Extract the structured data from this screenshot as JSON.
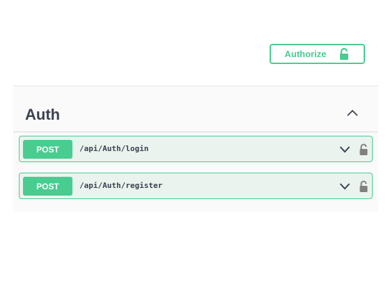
{
  "header": {
    "authorize_label": "Authorize",
    "authorize_icon": "unlocked-icon"
  },
  "tag": {
    "name": "Auth",
    "expanded": true,
    "operations": [
      {
        "method": "POST",
        "path": "/api/Auth/login"
      },
      {
        "method": "POST",
        "path": "/api/Auth/register"
      }
    ]
  },
  "colors": {
    "post_accent": "#49cc90",
    "post_background": "#ebf3ee",
    "text": "#3b4151",
    "lock_gray": "#808080"
  }
}
